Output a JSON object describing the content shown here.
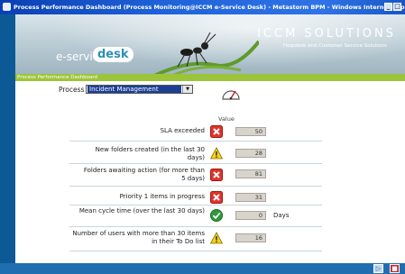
{
  "window": {
    "title": "Process Performance Dashboard (Process Monitoring@ICCM e-Service Desk) - Metastorm BPM - Windows Internet Explorer",
    "min_glyph": "_",
    "max_glyph": "□"
  },
  "banner": {
    "logo_prefix": "e-service",
    "logo_word": "desk",
    "brand": "ICCM SOLUTIONS",
    "tagline": "Helpdesk and Customer Service Solutions"
  },
  "section_title": "Process Performance Dashboard",
  "process": {
    "label": "Process",
    "selected": "Incident Management"
  },
  "value_header": "Value",
  "metrics": [
    {
      "label": "SLA exceeded",
      "status": "error",
      "value": "50",
      "unit": ""
    },
    {
      "label": "New folders created (in the last 30 days)",
      "status": "warning",
      "value": "28",
      "unit": ""
    },
    {
      "label": "Folders awaiting action (for more than 5 days)",
      "status": "error",
      "value": "81",
      "unit": ""
    },
    {
      "label": "Priority 1 items in progress",
      "status": "error",
      "value": "31",
      "unit": ""
    },
    {
      "label": "Mean cycle time (over the last 30 days)",
      "status": "ok",
      "value": "0",
      "unit": "Days"
    },
    {
      "label": "Number of users with more than 30 items in their To Do list",
      "status": "warning",
      "value": "16",
      "unit": ""
    }
  ],
  "colors": {
    "title_bar": "#1f62d9",
    "accent_green": "#9cc43a",
    "error": "#e0342c",
    "warning": "#f5d21a",
    "ok": "#2f9a3c"
  },
  "statusbar": {
    "play_icon": "play-icon",
    "stop_icon": "stop-icon"
  }
}
